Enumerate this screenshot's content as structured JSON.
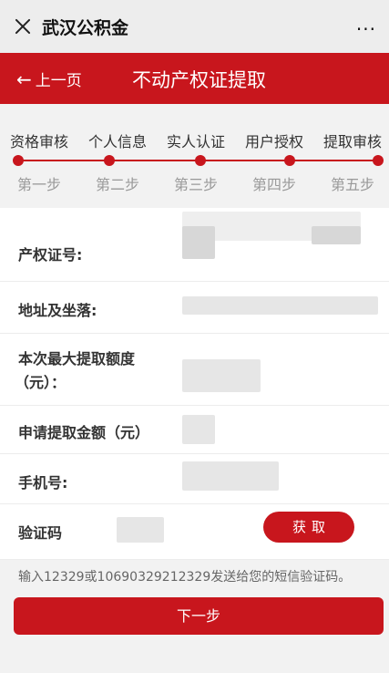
{
  "window": {
    "title": "武汉公积金",
    "close_icon": "close-icon",
    "more_label": "···"
  },
  "header": {
    "back_label": "上一页",
    "title": "不动产权证提取"
  },
  "steps": [
    {
      "name": "资格审核",
      "num": "第一步"
    },
    {
      "name": "个人信息",
      "num": "第二步"
    },
    {
      "name": "实人认证",
      "num": "第三步"
    },
    {
      "name": "用户授权",
      "num": "第四步"
    },
    {
      "name": "提取审核",
      "num": "第五步"
    }
  ],
  "form": {
    "cert_label": "产权证号:",
    "address_label": "地址及坐落:",
    "max_amount_label_1": "本次最大提取额度",
    "max_amount_label_2": "（元）：",
    "apply_amount_label": "申请提取金额（元）",
    "phone_label": "手机号:",
    "code_label": "验证码",
    "get_code_label": "获取"
  },
  "hint": "输入12329或10690329212329发送给您的短信验证码。",
  "next_label": "下一步",
  "colors": {
    "brand": "#c8161d"
  }
}
